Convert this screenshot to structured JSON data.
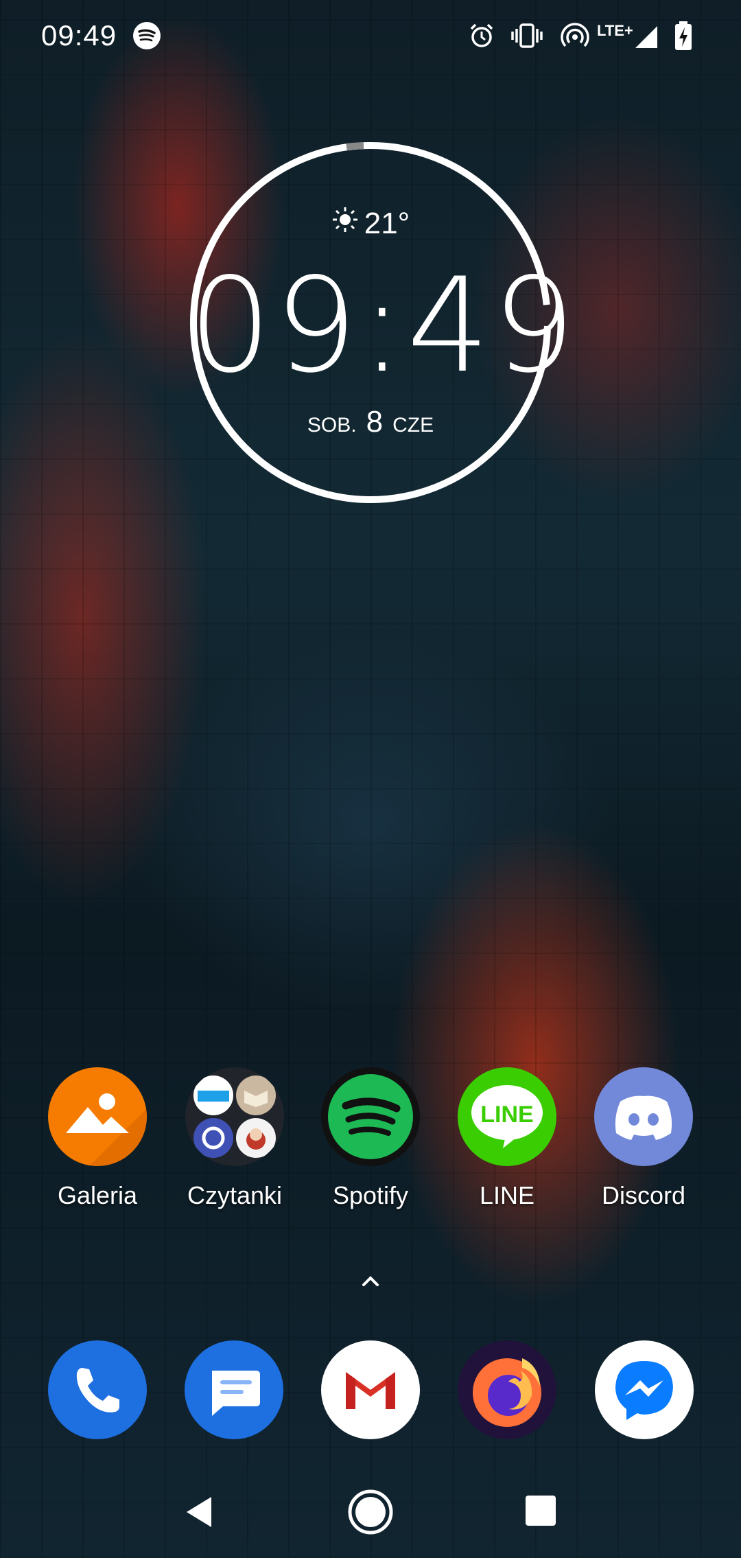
{
  "status_bar": {
    "time": "09:49",
    "icons": [
      "spotify-icon",
      "alarm-icon",
      "vibrate-icon",
      "hotspot-icon",
      "lte-signal-icon",
      "battery-charging-icon"
    ],
    "network_label": "LTE+"
  },
  "clock_widget": {
    "temperature": "21°",
    "weather_icon": "sun-icon",
    "time_hours": "09",
    "time_separator": ":",
    "time_minutes": "49",
    "day_of_week": "SOB.",
    "day": "8",
    "month": "CZE"
  },
  "apps": [
    {
      "label": "Galeria",
      "icon": "gallery-icon",
      "color": "#f57c00"
    },
    {
      "label": "Czytanki",
      "icon": "folder-icon",
      "color": "#2a2a2e"
    },
    {
      "label": "Spotify",
      "icon": "spotify-icon",
      "color": "#1db954"
    },
    {
      "label": "LINE",
      "icon": "line-icon",
      "color": "#3acd01"
    },
    {
      "label": "Discord",
      "icon": "discord-icon",
      "color": "#7289da"
    }
  ],
  "dock": [
    {
      "icon": "phone-icon",
      "color": "#1e6fe0"
    },
    {
      "icon": "messages-icon",
      "color": "#1e6fe0"
    },
    {
      "icon": "gmail-icon",
      "color": "#ffffff"
    },
    {
      "icon": "firefox-icon",
      "color": "#ff7139"
    },
    {
      "icon": "messenger-icon",
      "color": "#ffffff"
    }
  ],
  "navigation": {
    "buttons": [
      "back-button",
      "home-button",
      "recents-button"
    ]
  }
}
